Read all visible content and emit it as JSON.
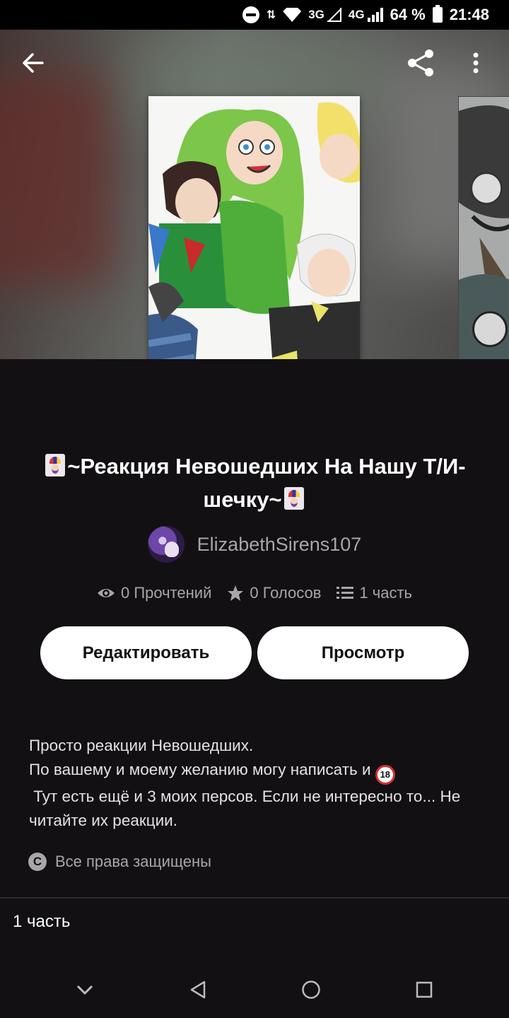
{
  "status_bar": {
    "network_3g": "3G",
    "network_4g": "4G",
    "battery": "64 %",
    "time": "21:48"
  },
  "nav": {
    "back_icon": "arrow-left-icon",
    "share_icon": "share-icon",
    "more_icon": "more-vertical-icon"
  },
  "story": {
    "title_text": "~Реакция Невошедших На Нашу Т/И-шечку~",
    "author": "ElizabethSirens107",
    "reads": "0 Прочтений",
    "votes": "0 Голосов",
    "parts": "1 часть",
    "description_line1": "Просто реакции Невошедших.",
    "description_line2": "По вашему и моему желанию могу написать и ",
    "description_line3": " Тут есть ещё и 3 моих персов. Если не интересно то... Не читайте их реакции.",
    "rights": "Все права защищены"
  },
  "buttons": {
    "edit": "Редактировать",
    "view": "Просмотр"
  },
  "parts_section": {
    "label": "1 часть"
  },
  "colors": {
    "background": "#121013",
    "button_bg": "#ffffff",
    "muted_text": "#a8a6ab"
  }
}
